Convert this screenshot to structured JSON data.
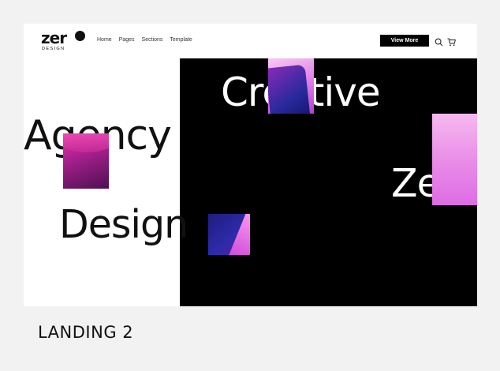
{
  "header": {
    "logo_text": "zer",
    "logo_sub": "DESIGN",
    "nav": [
      "Home",
      "Pages",
      "Sections",
      "Template"
    ],
    "cta_label": "View More",
    "icons": [
      "search-icon",
      "cart-icon"
    ]
  },
  "hero": {
    "word_creative": "Creative",
    "word_agency": "Agency",
    "word_design": "Design",
    "word_zero": "Ze"
  },
  "caption": "LANDING 2",
  "colors": {
    "background": "#f2f2f2",
    "hero_dark": "#000000",
    "accent_pink": "#e48ae9",
    "accent_magenta": "#a7208d",
    "accent_blue": "#2a2a9e"
  }
}
